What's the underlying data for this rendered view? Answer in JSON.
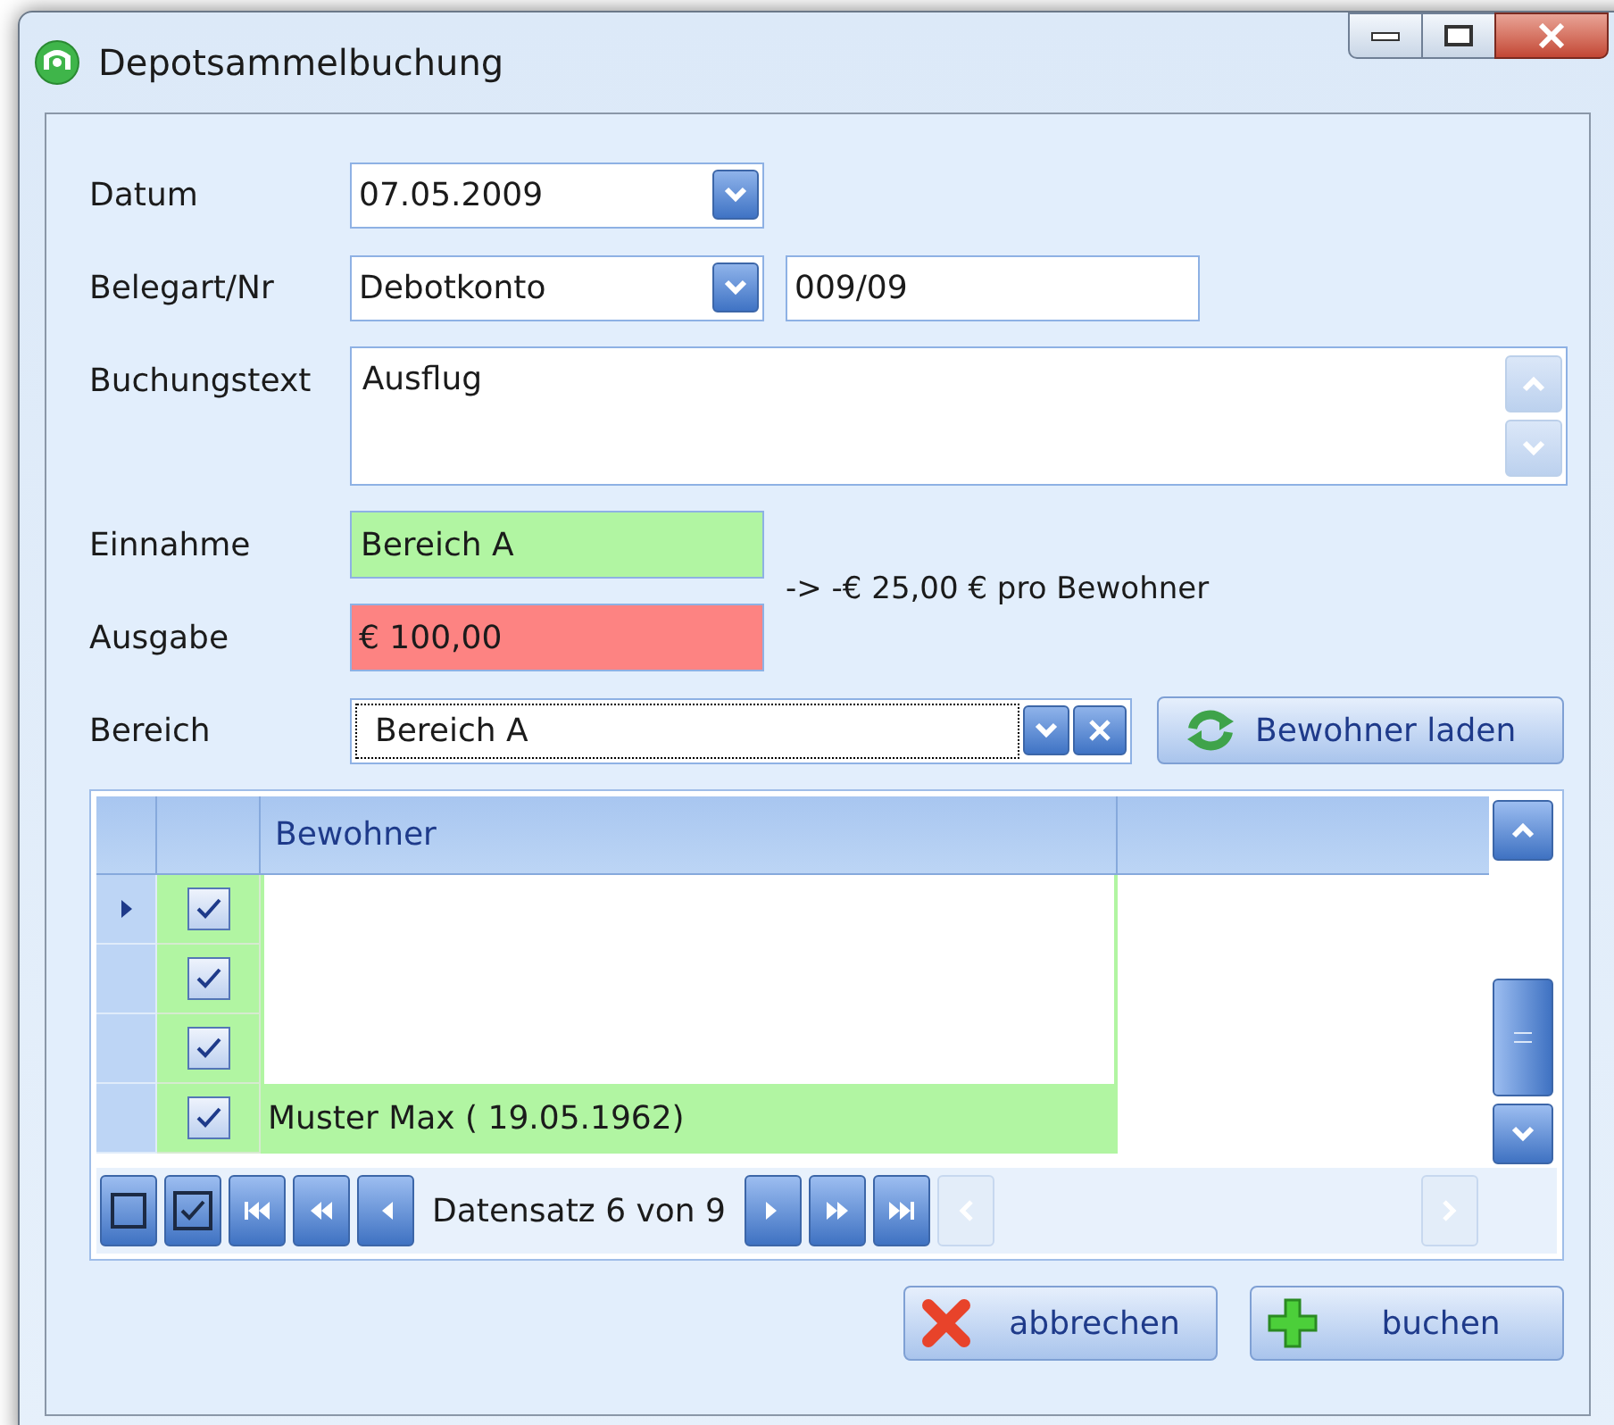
{
  "window": {
    "title": "Depotsammelbuchung"
  },
  "form": {
    "datum": {
      "label": "Datum",
      "value": "07.05.2009"
    },
    "belegart": {
      "label": "Belegart/Nr",
      "value": "Debotkonto",
      "number": "009/09"
    },
    "buchungstext": {
      "label": "Buchungstext",
      "value": "Ausflug"
    },
    "einnahme": {
      "label": "Einnahme",
      "value": "Bereich A"
    },
    "ausgabe": {
      "label": "Ausgabe",
      "value": "€ 100,00"
    },
    "per_resident_note": "-> -€ 25,00 € pro Bewohner",
    "bereich": {
      "label": "Bereich",
      "value": "Bereich A"
    },
    "load_button": "Bewohner laden"
  },
  "grid": {
    "columns": [
      "Bewohner"
    ],
    "rows": [
      {
        "selected": true,
        "checked": true
      },
      {
        "selected": false,
        "checked": true
      },
      {
        "selected": false,
        "checked": true
      },
      {
        "selected": false,
        "checked": true,
        "name": "Muster Max ( 19.05.1962)"
      }
    ],
    "record_status": "Datensatz 6 von 9"
  },
  "buttons": [
    {
      "label": "abbrechen",
      "kind": "cancel"
    },
    {
      "label": "buchen",
      "kind": "book"
    }
  ]
}
